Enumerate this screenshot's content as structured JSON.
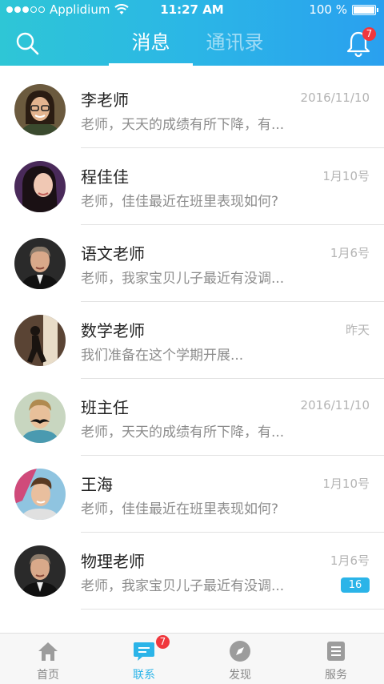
{
  "status_bar": {
    "carrier": "Applidium",
    "time": "11:27 AM",
    "battery": "100 %"
  },
  "header": {
    "tabs": [
      {
        "label": "消息",
        "active": true
      },
      {
        "label": "通讯录",
        "active": false
      }
    ],
    "notification_count": "7"
  },
  "messages": [
    {
      "name": "李老师",
      "time": "2016/11/10",
      "preview": "老师，天天的成绩有所下降，有...",
      "avatar": "female-glasses"
    },
    {
      "name": "程佳佳",
      "time": "1月10号",
      "preview": "老师，佳佳最近在班里表现如何?",
      "avatar": "female-long-hair"
    },
    {
      "name": "语文老师",
      "time": "1月6号",
      "preview": "老师，我家宝贝儿子最近有没调...",
      "avatar": "male-suit"
    },
    {
      "name": "数学老师",
      "time": "昨天",
      "preview": "我们准备在这个学期开展...",
      "avatar": "female-silhouette"
    },
    {
      "name": "班主任",
      "time": "2016/11/10",
      "preview": "老师，天天的成绩有所下降，有...",
      "avatar": "male-mustache"
    },
    {
      "name": "王海",
      "time": "1月10号",
      "preview": "老师，佳佳最近在班里表现如何?",
      "avatar": "male-young"
    },
    {
      "name": "物理老师",
      "time": "1月6号",
      "preview": "老师，我家宝贝儿子最近有没调...",
      "avatar": "male-suit",
      "unread": "16"
    }
  ],
  "tabbar": {
    "items": [
      {
        "label": "首页",
        "icon": "home-icon"
      },
      {
        "label": "联系",
        "icon": "chat-icon",
        "active": true,
        "badge": "7"
      },
      {
        "label": "发现",
        "icon": "compass-icon"
      },
      {
        "label": "服务",
        "icon": "list-icon"
      }
    ]
  },
  "colors": {
    "header_start": "#2ec6d6",
    "header_end": "#2aa0ef",
    "accent": "#2bb4e8",
    "badge_red": "#f0373d"
  }
}
